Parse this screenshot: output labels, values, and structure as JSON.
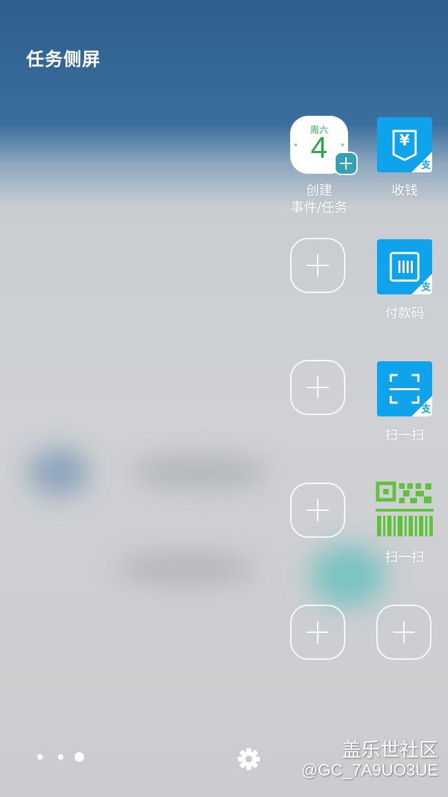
{
  "header": {
    "title": "任务侧屏"
  },
  "shortcuts": {
    "calendar": {
      "day_of_week": "周六",
      "date": "4",
      "label": "创建\n事件/任务"
    },
    "collect_money": {
      "label": "收钱",
      "symbol": "¥",
      "badge": "支"
    },
    "payment_code": {
      "label": "付款码",
      "badge": "支"
    },
    "scan_alipay": {
      "label": "扫一扫",
      "badge": "支"
    },
    "scan_wechat": {
      "label": "扫一扫"
    }
  },
  "pager": {
    "count": 3,
    "active_index": 2
  },
  "settings": {
    "icon": "gear-icon"
  },
  "watermark": {
    "line1": "盖乐世社区",
    "line2": "@GC_7A9UO3UE"
  },
  "colors": {
    "alipay_blue": "#0fa3eb",
    "calendar_green": "#2aa84a",
    "qr_green": "#5ec23b"
  }
}
